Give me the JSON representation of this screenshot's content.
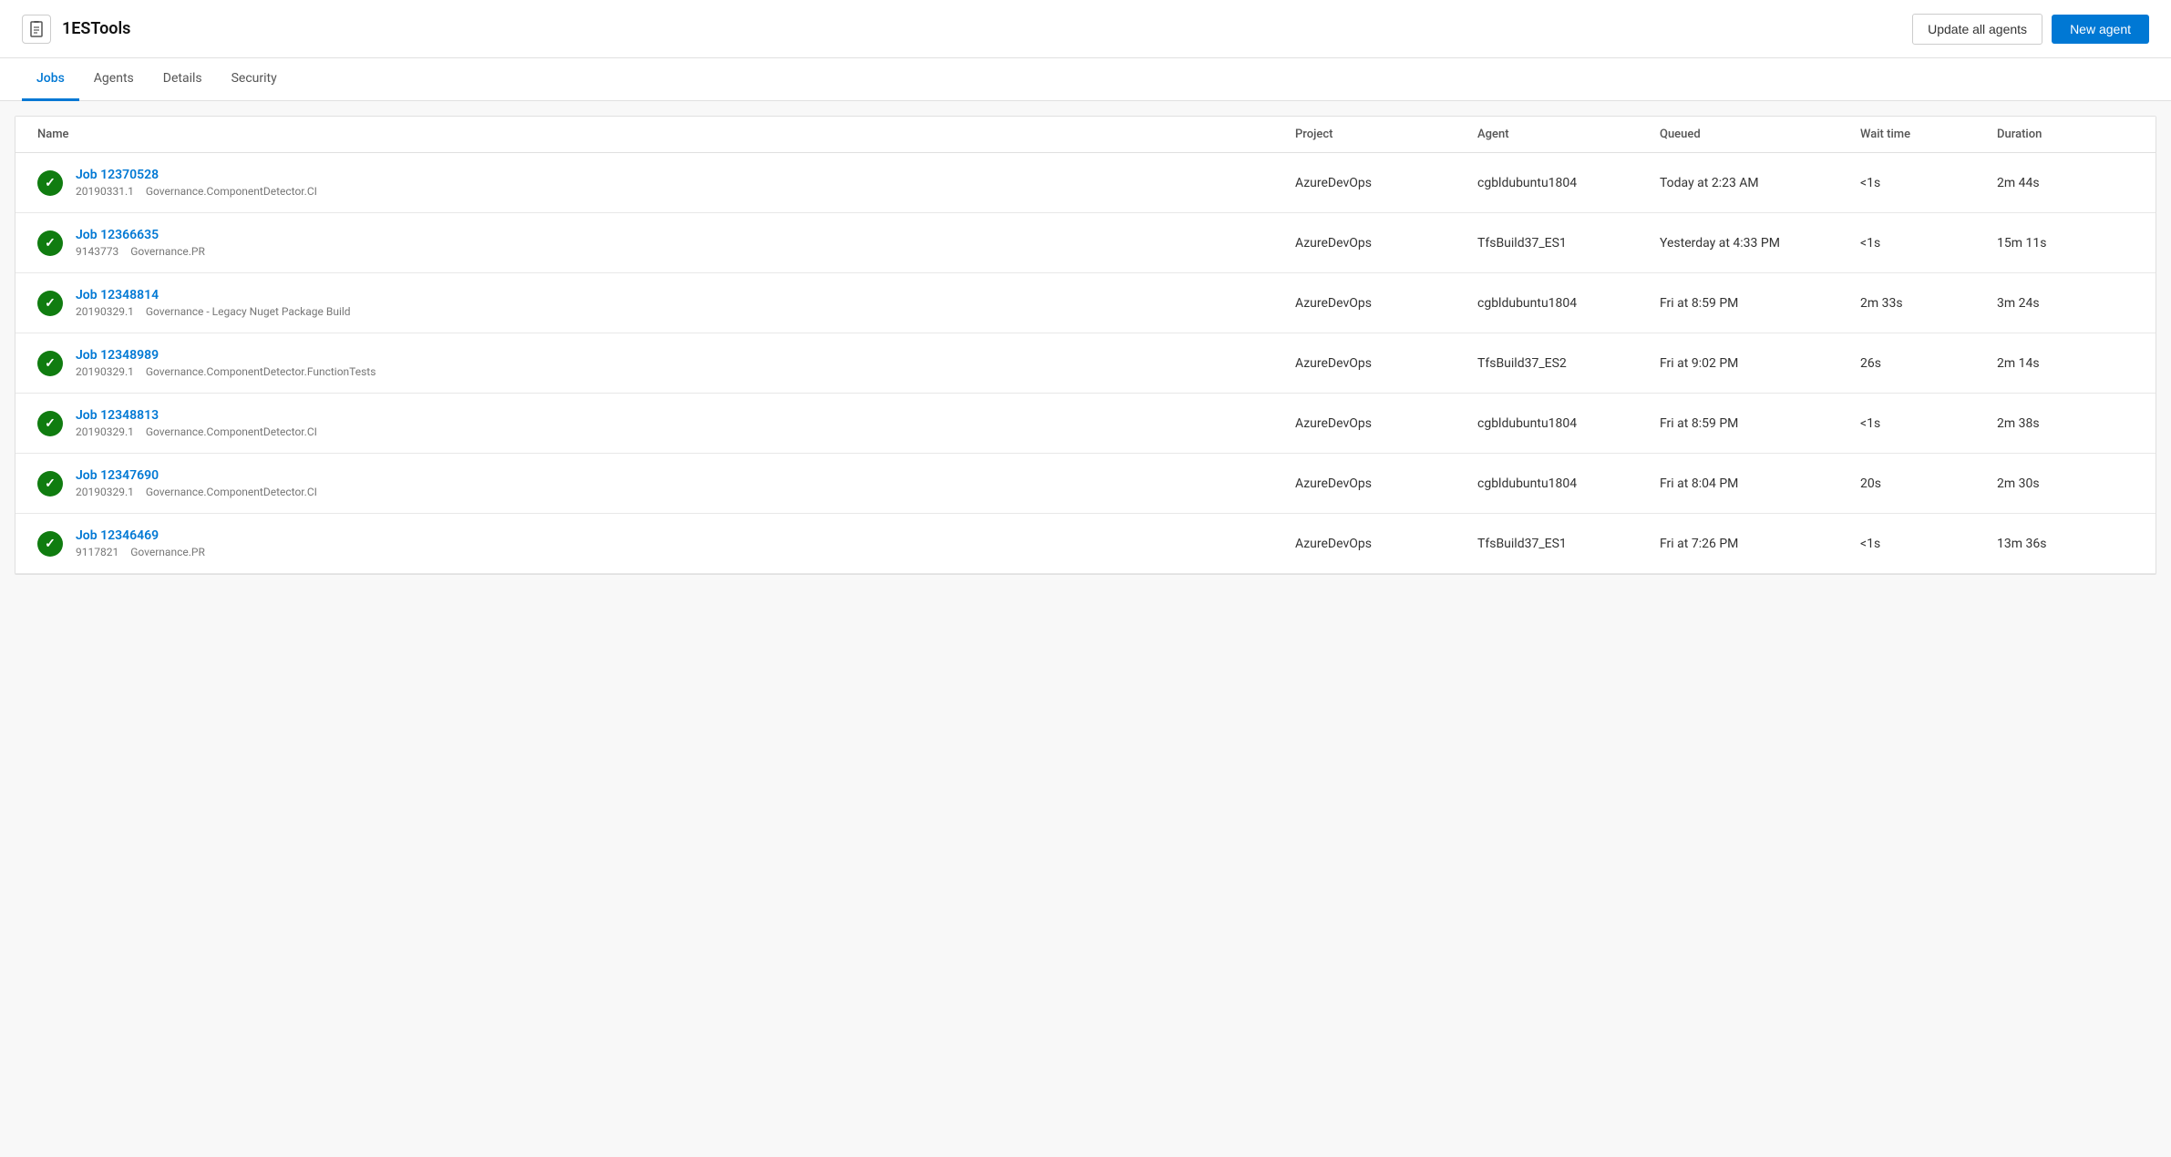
{
  "app": {
    "title": "1ESTools",
    "icon": "📱"
  },
  "header": {
    "update_agents_label": "Update all agents",
    "new_agent_label": "New agent"
  },
  "nav": {
    "tabs": [
      {
        "id": "jobs",
        "label": "Jobs",
        "active": true
      },
      {
        "id": "agents",
        "label": "Agents",
        "active": false
      },
      {
        "id": "details",
        "label": "Details",
        "active": false
      },
      {
        "id": "security",
        "label": "Security",
        "active": false
      }
    ]
  },
  "table": {
    "columns": [
      "Name",
      "Project",
      "Agent",
      "Queued",
      "Wait time",
      "Duration"
    ],
    "rows": [
      {
        "job_id": "Job 12370528",
        "build_number": "20190331.1",
        "pipeline": "Governance.ComponentDetector.CI",
        "project": "AzureDevOps",
        "agent": "cgbldubuntu1804",
        "queued": "Today at 2:23 AM",
        "wait_time": "<1s",
        "duration": "2m 44s",
        "status": "success"
      },
      {
        "job_id": "Job 12366635",
        "build_number": "9143773",
        "pipeline": "Governance.PR",
        "project": "AzureDevOps",
        "agent": "TfsBuild37_ES1",
        "queued": "Yesterday at 4:33 PM",
        "wait_time": "<1s",
        "duration": "15m 11s",
        "status": "success"
      },
      {
        "job_id": "Job 12348814",
        "build_number": "20190329.1",
        "pipeline": "Governance - Legacy Nuget Package Build",
        "project": "AzureDevOps",
        "agent": "cgbldubuntu1804",
        "queued": "Fri at 8:59 PM",
        "wait_time": "2m 33s",
        "duration": "3m 24s",
        "status": "success"
      },
      {
        "job_id": "Job 12348989",
        "build_number": "20190329.1",
        "pipeline": "Governance.ComponentDetector.FunctionTests",
        "project": "AzureDevOps",
        "agent": "TfsBuild37_ES2",
        "queued": "Fri at 9:02 PM",
        "wait_time": "26s",
        "duration": "2m 14s",
        "status": "success"
      },
      {
        "job_id": "Job 12348813",
        "build_number": "20190329.1",
        "pipeline": "Governance.ComponentDetector.CI",
        "project": "AzureDevOps",
        "agent": "cgbldubuntu1804",
        "queued": "Fri at 8:59 PM",
        "wait_time": "<1s",
        "duration": "2m 38s",
        "status": "success"
      },
      {
        "job_id": "Job 12347690",
        "build_number": "20190329.1",
        "pipeline": "Governance.ComponentDetector.CI",
        "project": "AzureDevOps",
        "agent": "cgbldubuntu1804",
        "queued": "Fri at 8:04 PM",
        "wait_time": "20s",
        "duration": "2m 30s",
        "status": "success"
      },
      {
        "job_id": "Job 12346469",
        "build_number": "9117821",
        "pipeline": "Governance.PR",
        "project": "AzureDevOps",
        "agent": "TfsBuild37_ES1",
        "queued": "Fri at 7:26 PM",
        "wait_time": "<1s",
        "duration": "13m 36s",
        "status": "success"
      }
    ]
  }
}
